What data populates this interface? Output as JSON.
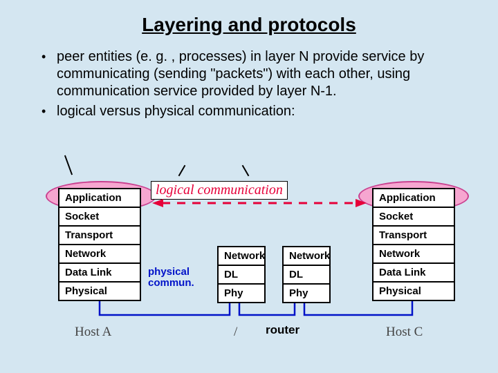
{
  "title": "Layering and protocols",
  "bullets": {
    "items": [
      "peer entities (e. g. , processes) in layer N provide service by communicating (sending \"packets\") with each other, using communication service provided by layer N-1.",
      "logical versus physical communication:"
    ]
  },
  "diagram": {
    "logical_label": "logical communication",
    "physical_label_line1": "physical",
    "physical_label_line2": "commun.",
    "router_label": "router",
    "hosts": {
      "a": "Host A",
      "c": "Host C"
    },
    "host_stack": {
      "layers": [
        "Application",
        "Socket",
        "Transport",
        "Network",
        "Data Link",
        "Physical"
      ]
    },
    "router_stack": {
      "layers": [
        "Network",
        "DL",
        "Phy"
      ]
    }
  }
}
